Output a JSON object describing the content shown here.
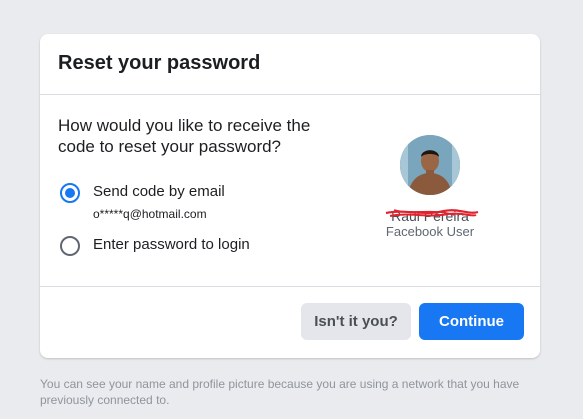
{
  "dialog": {
    "title": "Reset your password",
    "question": "How would you like to receive the code to reset your password?",
    "options": [
      {
        "label": "Send code by email",
        "detail": "o*****q@hotmail.com",
        "selected": true
      },
      {
        "label": "Enter password to login",
        "detail": "",
        "selected": false
      }
    ],
    "profile": {
      "name": "Raul Pereira",
      "subtitle": "Facebook User"
    },
    "buttons": {
      "secondary": "Isn't it you?",
      "primary": "Continue"
    }
  },
  "footer_note": "You can see your name and profile picture because you are using a network that you have previously connected to.",
  "colors": {
    "primary": "#1877f2",
    "background": "#e9ebee",
    "redaction": "#e0232e"
  }
}
